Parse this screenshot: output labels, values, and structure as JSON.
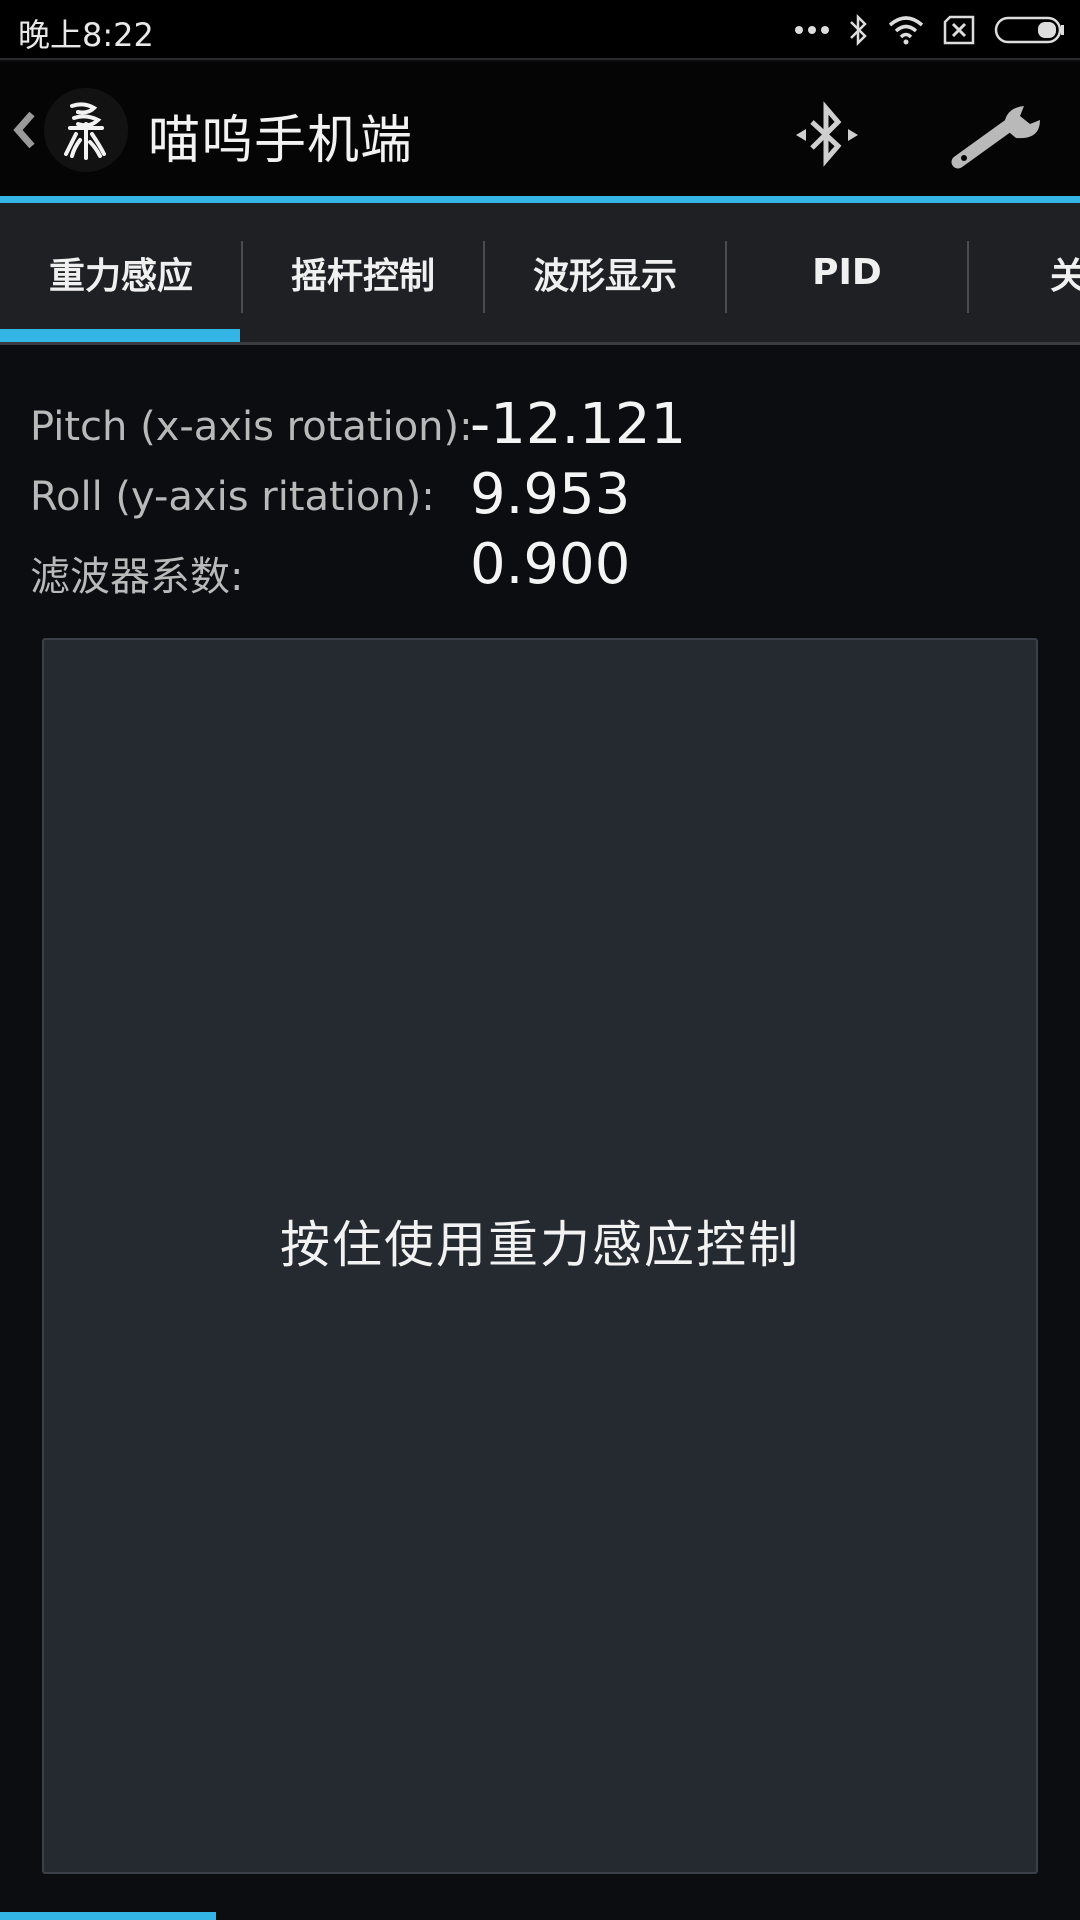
{
  "status_bar": {
    "time": "晚上8:22",
    "icons": [
      "more-dots-icon",
      "bluetooth-icon",
      "wifi-icon",
      "sim-off-icon",
      "battery-icon"
    ]
  },
  "action_bar": {
    "title": "喵呜手机端",
    "icons": [
      "up-chevron-icon",
      "app-logo-icon",
      "bluetooth-connect-icon",
      "wrench-icon"
    ],
    "accent_color": "#33b5e5"
  },
  "tabs": [
    {
      "label": "重力感应",
      "selected": true
    },
    {
      "label": "摇杆控制",
      "selected": false
    },
    {
      "label": "波形显示",
      "selected": false
    },
    {
      "label": "PID",
      "selected": false
    },
    {
      "label": "关",
      "selected": false
    }
  ],
  "readouts": [
    {
      "label": "Pitch (x-axis rotation):",
      "value": "-12.121"
    },
    {
      "label": "Roll (y-axis ritation):",
      "value": "9.953"
    },
    {
      "label": "滤波器系数:",
      "value": "0.900"
    }
  ],
  "control_pad": {
    "label": "按住使用重力感应控制"
  }
}
